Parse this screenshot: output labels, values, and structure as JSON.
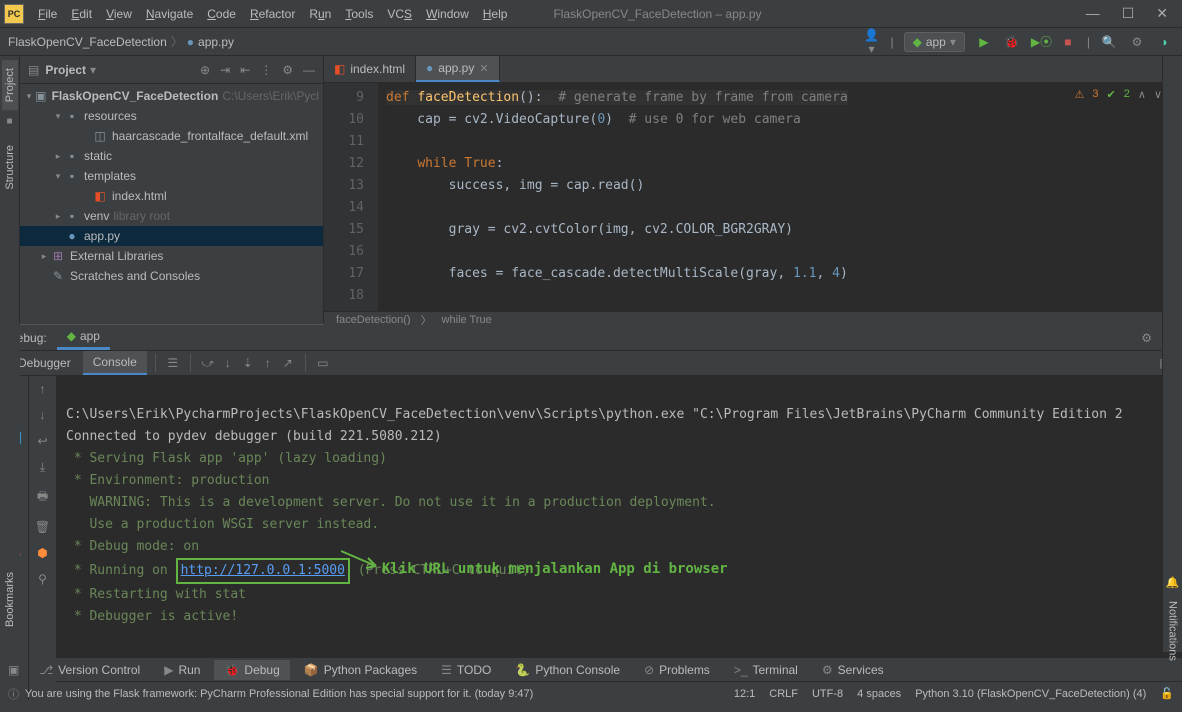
{
  "window": {
    "title": "FlaskOpenCV_FaceDetection – app.py"
  },
  "menu": [
    "File",
    "Edit",
    "View",
    "Navigate",
    "Code",
    "Refactor",
    "Run",
    "Tools",
    "VCS",
    "Window",
    "Help"
  ],
  "breadcrumb": {
    "project": "FlaskOpenCV_FaceDetection",
    "file": "app.py"
  },
  "run_config": {
    "label": "app"
  },
  "project_tree": {
    "root_name": "FlaskOpenCV_FaceDetection",
    "root_path": "C:\\Users\\Erik\\Pycl",
    "items": [
      {
        "indent": 2,
        "arrow": "▾",
        "icon": "folder",
        "label": "resources"
      },
      {
        "indent": 4,
        "arrow": "",
        "icon": "xml",
        "label": "haarcascade_frontalface_default.xml"
      },
      {
        "indent": 2,
        "arrow": "▸",
        "icon": "folder",
        "label": "static"
      },
      {
        "indent": 2,
        "arrow": "▾",
        "icon": "folder",
        "label": "templates"
      },
      {
        "indent": 4,
        "arrow": "",
        "icon": "html",
        "label": "index.html"
      },
      {
        "indent": 2,
        "arrow": "▸",
        "icon": "folder",
        "label": "venv",
        "meta": "library root"
      },
      {
        "indent": 2,
        "arrow": "",
        "icon": "py",
        "label": "app.py",
        "selected": true
      },
      {
        "indent": 1,
        "arrow": "▸",
        "icon": "lib",
        "label": "External Libraries"
      },
      {
        "indent": 1,
        "arrow": "",
        "icon": "scratch",
        "label": "Scratches and Consoles"
      }
    ]
  },
  "editor": {
    "tabs": [
      {
        "icon": "html",
        "label": "index.html",
        "active": false
      },
      {
        "icon": "py",
        "label": "app.py",
        "active": true
      }
    ],
    "status": {
      "warn": "3",
      "ok": "2"
    },
    "line_numbers": [
      "9",
      "10",
      "11",
      "12",
      "13",
      "14",
      "15",
      "16",
      "17",
      "18"
    ],
    "crumbs": [
      "faceDetection()",
      "while True"
    ]
  },
  "debug": {
    "label": "Debug:",
    "tab": "app",
    "subtabs": [
      "Debugger",
      "Console"
    ],
    "console_lines": {
      "l1": "C:\\Users\\Erik\\PycharmProjects\\FlaskOpenCV_FaceDetection\\venv\\Scripts\\python.exe \"C:\\Program Files\\JetBrains\\PyCharm Community Edition 2",
      "l2": "Connected to pydev debugger (build 221.5080.212)",
      "l3": " * Serving Flask app 'app' (lazy loading)",
      "l4": " * Environment: production",
      "l5": "   WARNING: This is a development server. Do not use it in a production deployment.",
      "l6": "   Use a production WSGI server instead.",
      "l7": " * Debug mode: on",
      "l8a": " * Running on ",
      "l8_url": "http://127.0.0.1:5000",
      "l8b": " (Press CTRL+C to quit)",
      "l9": " * Restarting with stat",
      "l10": " * Debugger is active!"
    },
    "annotation": "Klik URL untuk menjalankan App di browser"
  },
  "bottom_tabs": [
    {
      "icon": "⎇",
      "label": "Version Control"
    },
    {
      "icon": "▶",
      "label": "Run"
    },
    {
      "icon": "🐞",
      "label": "Debug",
      "active": true
    },
    {
      "icon": "📦",
      "label": "Python Packages"
    },
    {
      "icon": "☰",
      "label": "TODO"
    },
    {
      "icon": "🐍",
      "label": "Python Console"
    },
    {
      "icon": "⊘",
      "label": "Problems"
    },
    {
      "icon": ">_",
      "label": "Terminal"
    },
    {
      "icon": "⚙",
      "label": "Services"
    }
  ],
  "statusbar": {
    "message": "You are using the Flask framework: PyCharm Professional Edition has special support for it. (today 9:47)",
    "pos": "12:1",
    "eol": "CRLF",
    "enc": "UTF-8",
    "indent": "4 spaces",
    "interpreter": "Python 3.10 (FlaskOpenCV_FaceDetection) (4)"
  },
  "side_panels": {
    "project": "Project",
    "structure": "Structure",
    "bookmarks": "Bookmarks",
    "notifications": "Notifications"
  }
}
